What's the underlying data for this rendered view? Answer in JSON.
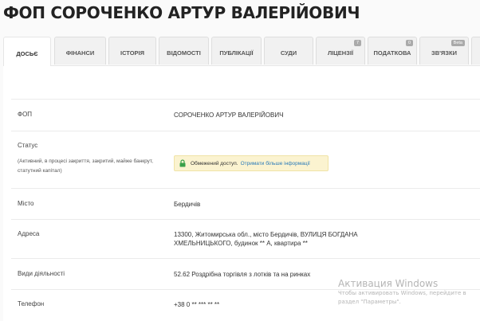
{
  "page": {
    "title": "ФОП СОРОЧЕНКО АРТУР ВАЛЕРІЙОВИЧ"
  },
  "tabs": [
    {
      "label": "ДОСЬЄ",
      "active": true
    },
    {
      "label": "ФІНАНСИ"
    },
    {
      "label": "ІСТОРІЯ"
    },
    {
      "label": "ВІДОМОСТІ"
    },
    {
      "label": "ПУБЛІКАЦІЇ"
    },
    {
      "label": "СУДИ"
    },
    {
      "label": "ЛІЦЕНЗІЇ",
      "badge": "7"
    },
    {
      "label": "ПОДАТКОВА",
      "badge": "0"
    },
    {
      "label": "ЗВ'ЯЗКИ",
      "badge": "Beta"
    }
  ],
  "details": {
    "fop": {
      "label": "ФОП",
      "value": "СОРОЧЕНКО АРТУР ВАЛЕРІЙОВИЧ"
    },
    "status": {
      "label": "Статус",
      "sublabel": "(Активний, в процесі закриття, закритий, майже банкрут, статутний капітал)",
      "notice_text": "Обмежений доступ.",
      "notice_link": "Отримати більше інформації"
    },
    "city": {
      "label": "Місто",
      "value": "Бердичів"
    },
    "address": {
      "label": "Адреса",
      "value_line1": "13300, Житомирська обл., місто Бердичів, ВУЛИЦЯ БОГДАНА",
      "value_line2": "ХМЕЛЬНИЦЬКОГО, будинок ** А, квартира **"
    },
    "activities": {
      "label": "Види діяльності",
      "value": "52.62 Роздрібна торгівля з лотків та на ринках"
    },
    "phone": {
      "label": "Телефон",
      "value": "+38 0 ** *** ** **"
    }
  },
  "watermark": {
    "line1": "Активация Windows",
    "line2": "Чтобы активировать Windows, перейдите в",
    "line3": "раздел \"Параметры\"."
  },
  "colors": {
    "notice_bg": "#fbf3d0",
    "link": "#2a7ab8",
    "lock": "#3aa04a"
  }
}
